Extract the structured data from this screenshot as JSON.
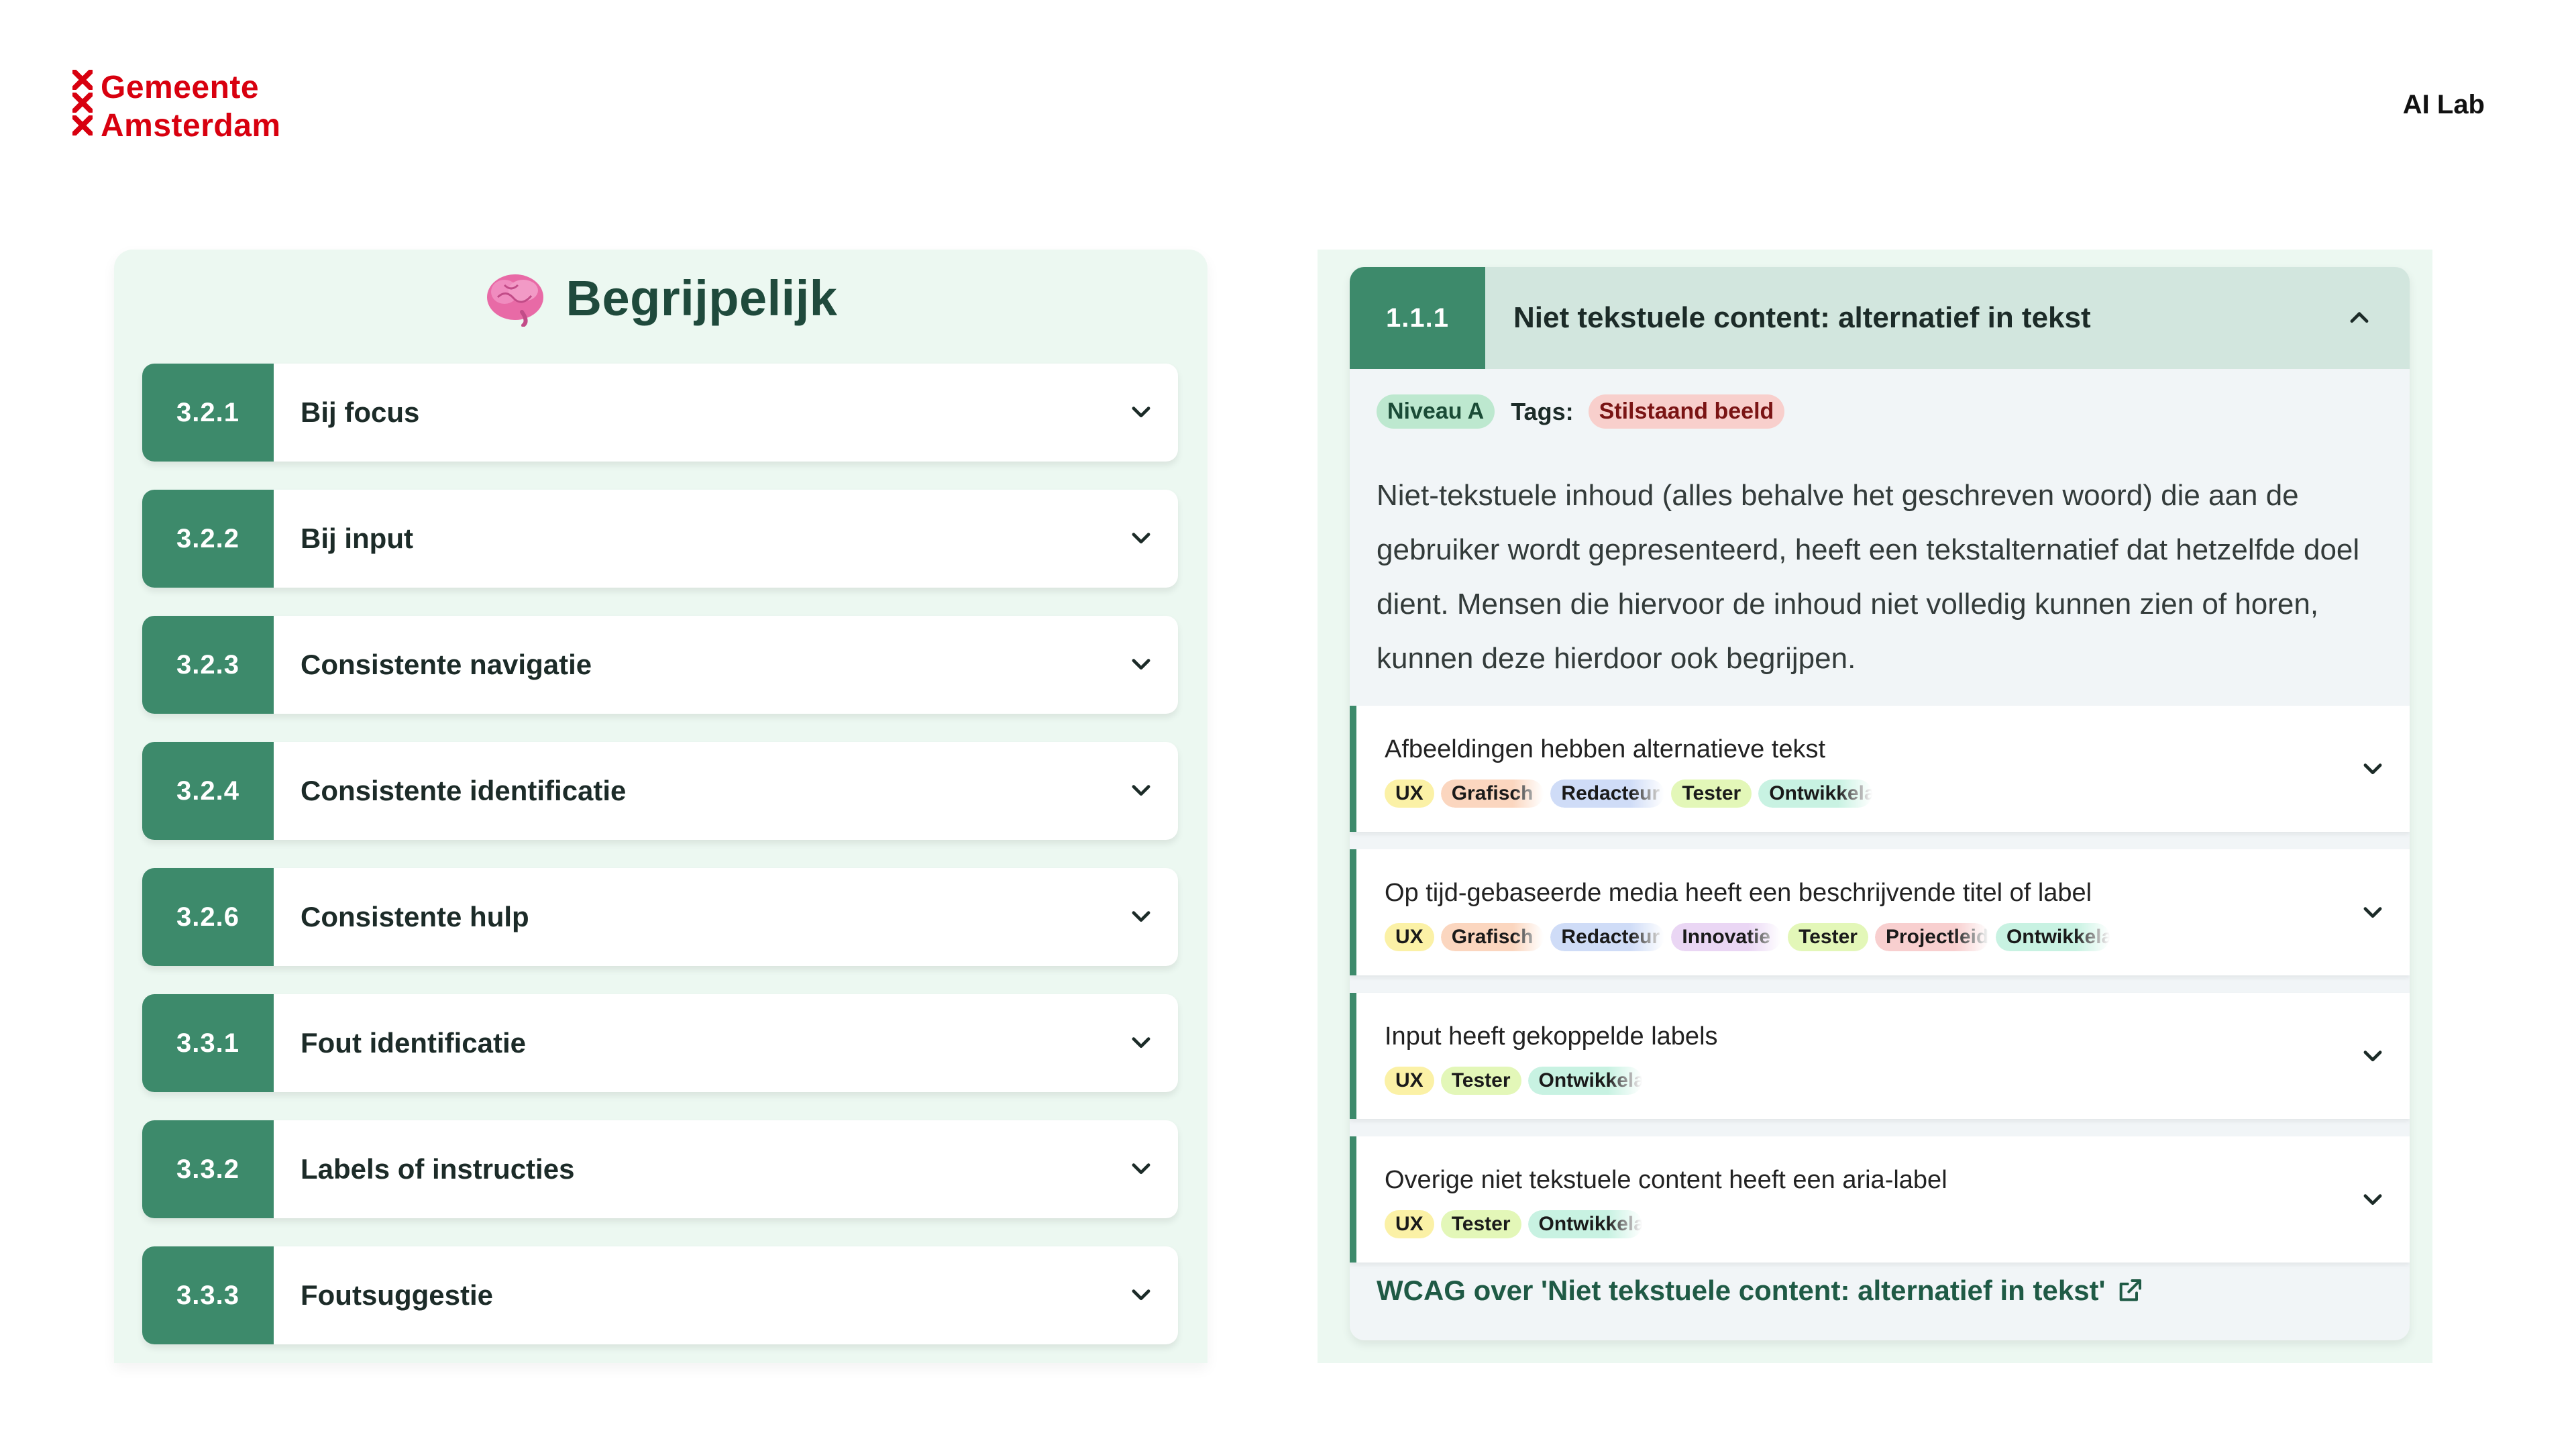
{
  "header": {
    "logo_line1": "Gemeente",
    "logo_line2": "Amsterdam",
    "lab_label": "AI Lab"
  },
  "left_panel": {
    "title": "Begrijpelijk",
    "icon": "brain-icon",
    "criteria": [
      {
        "number": "3.2.1",
        "label": "Bij focus"
      },
      {
        "number": "3.2.2",
        "label": "Bij input"
      },
      {
        "number": "3.2.3",
        "label": "Consistente navigatie"
      },
      {
        "number": "3.2.4",
        "label": "Consistente identificatie"
      },
      {
        "number": "3.2.6",
        "label": "Consistente hulp"
      },
      {
        "number": "3.3.1",
        "label": "Fout identificatie"
      },
      {
        "number": "3.3.2",
        "label": "Labels of instructies"
      },
      {
        "number": "3.3.3",
        "label": "Foutsuggestie"
      }
    ]
  },
  "detail": {
    "number": "1.1.1",
    "title": "Niet tekstuele content: alternatief in tekst",
    "level": "Niveau A",
    "tags_label": "Tags:",
    "tag": "Stilstaand beeld",
    "description": "Niet-tekstuele inhoud (alles behalve het geschreven woord) die aan de gebruiker wordt gepresenteerd, heeft een tekstalternatief dat hetzelfde doel dient. Mensen die hiervoor de inhoud niet volledig kunnen zien of horen, kunnen deze hierdoor ook begrijpen.",
    "checks": [
      {
        "title": "Afbeeldingen hebben alternatieve tekst",
        "roles": [
          "UX",
          "Grafisch",
          "Redacteur",
          "Tester",
          "Ontwikkelaar"
        ]
      },
      {
        "title": "Op tijd-gebaseerde media heeft een beschrijvende titel of label",
        "roles": [
          "UX",
          "Grafisch",
          "Redacteur",
          "Innovatie",
          "Tester",
          "Projectleider",
          "Ontwikkelaar"
        ]
      },
      {
        "title": "Input heeft gekoppelde labels",
        "roles": [
          "UX",
          "Tester",
          "Ontwikkelaar"
        ]
      },
      {
        "title": "Overige niet tekstuele content heeft een aria-label",
        "roles": [
          "UX",
          "Tester",
          "Ontwikkelaar"
        ]
      }
    ],
    "wcag_link": "WCAG over 'Niet tekstuele content: alternatief in tekst'"
  },
  "colors": {
    "brand_red": "#d8000f",
    "accent_green": "#3d8a6b",
    "panel_bg": "#ecf8f1",
    "role_colors": {
      "UX": "#fbf1a6",
      "Grafisch": "#fbd6bf",
      "Redacteur": "#cfdcf7",
      "Tester": "#e3f7b8",
      "Ontwikkelaar": "#c8f2e2",
      "Innovatie": "#ead6f4",
      "Projectleider": "#f8cfcf"
    }
  }
}
